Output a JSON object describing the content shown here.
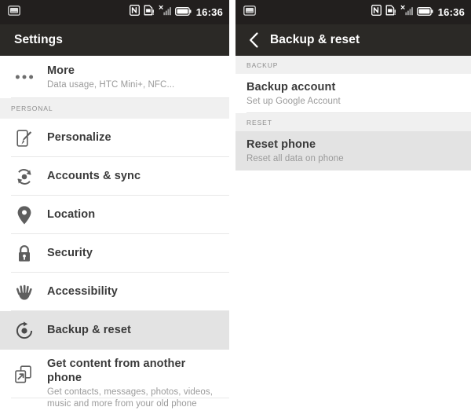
{
  "status_bar": {
    "notification_icon": "screenshot-icon",
    "icons": [
      "nfc-icon",
      "sd-card-warning-icon",
      "signal-bars-no-service-icon",
      "battery-icon"
    ],
    "time": "16:36"
  },
  "left_panel": {
    "title": "Settings",
    "items": [
      {
        "icon": "more-dots-icon",
        "title": "More",
        "subtitle": "Data usage, HTC Mini+, NFC...",
        "selected": false
      },
      {
        "section": "PERSONAL"
      },
      {
        "icon": "personalize-brush-icon",
        "title": "Personalize",
        "subtitle": "",
        "selected": false
      },
      {
        "icon": "accounts-sync-icon",
        "title": "Accounts & sync",
        "subtitle": "",
        "selected": false
      },
      {
        "icon": "location-pin-icon",
        "title": "Location",
        "subtitle": "",
        "selected": false
      },
      {
        "icon": "security-lock-icon",
        "title": "Security",
        "subtitle": "",
        "selected": false
      },
      {
        "icon": "accessibility-hand-icon",
        "title": "Accessibility",
        "subtitle": "",
        "selected": false
      },
      {
        "icon": "backup-reset-icon",
        "title": "Backup & reset",
        "subtitle": "",
        "selected": true
      },
      {
        "icon": "transfer-phone-icon",
        "title": "Get content from another phone",
        "subtitle_line1": "Get contacts, messages, photos, videos,",
        "subtitle_line2": "music and more from your old phone",
        "selected": false
      }
    ]
  },
  "right_panel": {
    "back_icon": "back-chevron-icon",
    "title": "Backup & reset",
    "sections": [
      {
        "label": "BACKUP",
        "items": [
          {
            "title": "Backup account",
            "subtitle": "Set up Google Account",
            "selected": false
          }
        ]
      },
      {
        "label": "RESET",
        "items": [
          {
            "title": "Reset phone",
            "subtitle": "Reset all data on phone",
            "selected": true
          }
        ]
      }
    ]
  },
  "colors": {
    "status_bar_bg": "#221f1e",
    "action_bar_bg": "#2b2926",
    "selected_row_bg": "#e3e3e3",
    "section_band_bg": "#f0f0f0",
    "title_text": "#3a3a3a",
    "subtitle_text": "#9a9a9a",
    "section_label_text": "#8d8d8d",
    "divider": "#e8e8e8",
    "page_bg": "#ffffff"
  }
}
